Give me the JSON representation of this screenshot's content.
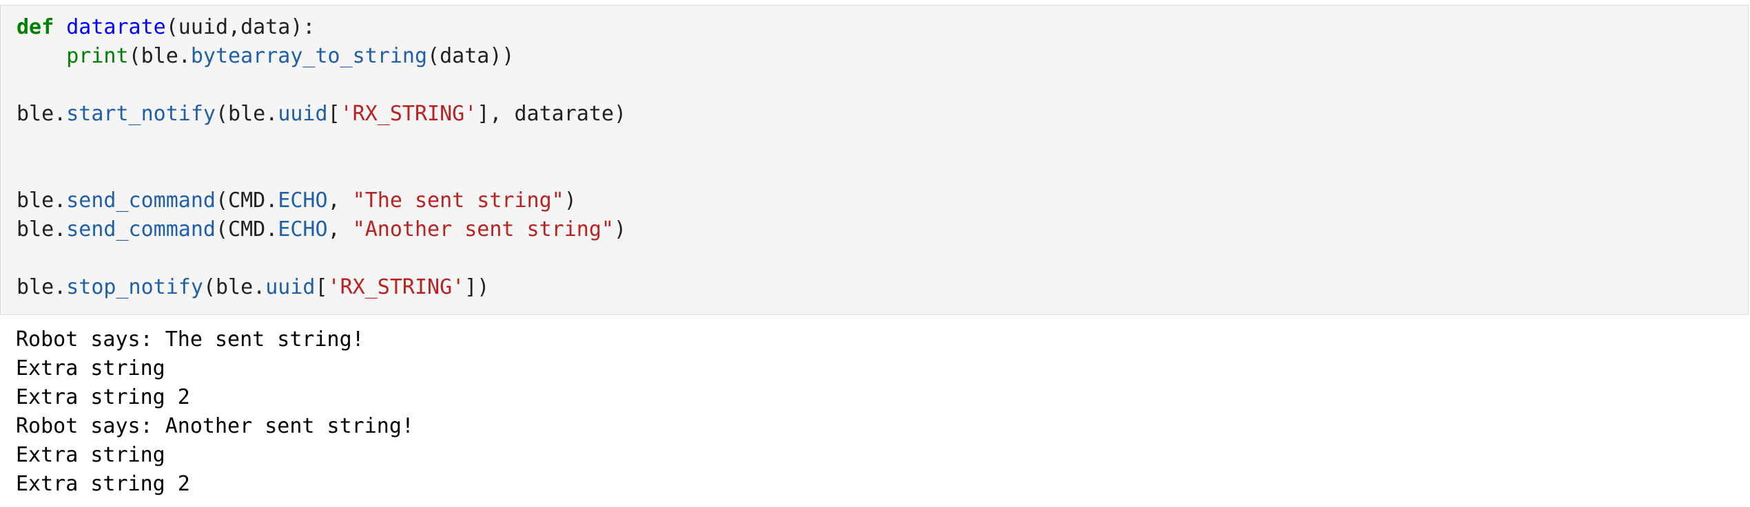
{
  "code_cell": {
    "lines": [
      [
        {
          "text": "def",
          "kind": "kw"
        },
        {
          "text": " ",
          "kind": "plain"
        },
        {
          "text": "datarate",
          "kind": "fn"
        },
        {
          "text": "(uuid,data):",
          "kind": "plain"
        }
      ],
      [
        {
          "text": "    ",
          "kind": "plain"
        },
        {
          "text": "print",
          "kind": "bi"
        },
        {
          "text": "(ble.",
          "kind": "plain"
        },
        {
          "text": "bytearray_to_string",
          "kind": "attr"
        },
        {
          "text": "(data))",
          "kind": "plain"
        }
      ],
      [],
      [
        {
          "text": "ble.",
          "kind": "plain"
        },
        {
          "text": "start_notify",
          "kind": "attr"
        },
        {
          "text": "(ble.",
          "kind": "plain"
        },
        {
          "text": "uuid",
          "kind": "attr"
        },
        {
          "text": "[",
          "kind": "plain"
        },
        {
          "text": "'RX_STRING'",
          "kind": "str"
        },
        {
          "text": "], datarate)",
          "kind": "plain"
        }
      ],
      [],
      [],
      [
        {
          "text": "ble.",
          "kind": "plain"
        },
        {
          "text": "send_command",
          "kind": "attr"
        },
        {
          "text": "(CMD.",
          "kind": "plain"
        },
        {
          "text": "ECHO",
          "kind": "attr"
        },
        {
          "text": ", ",
          "kind": "plain"
        },
        {
          "text": "\"The sent string\"",
          "kind": "str"
        },
        {
          "text": ")",
          "kind": "plain"
        }
      ],
      [
        {
          "text": "ble.",
          "kind": "plain"
        },
        {
          "text": "send_command",
          "kind": "attr"
        },
        {
          "text": "(CMD.",
          "kind": "plain"
        },
        {
          "text": "ECHO",
          "kind": "attr"
        },
        {
          "text": ", ",
          "kind": "plain"
        },
        {
          "text": "\"Another sent string\"",
          "kind": "str"
        },
        {
          "text": ")",
          "kind": "plain"
        }
      ],
      [],
      [
        {
          "text": "ble.",
          "kind": "plain"
        },
        {
          "text": "stop_notify",
          "kind": "attr"
        },
        {
          "text": "(ble.",
          "kind": "plain"
        },
        {
          "text": "uuid",
          "kind": "attr"
        },
        {
          "text": "[",
          "kind": "plain"
        },
        {
          "text": "'RX_STRING'",
          "kind": "str"
        },
        {
          "text": "])",
          "kind": "plain"
        }
      ]
    ]
  },
  "output": {
    "lines": [
      "Robot says: The sent string!",
      "Extra string",
      "Extra string 2",
      "Robot says: Another sent string!",
      "Extra string",
      "Extra string 2"
    ]
  },
  "colors": {
    "keyword": "#008000",
    "function_name": "#0000ff",
    "builtin": "#008000",
    "attribute": "#1f5fa8",
    "string": "#ba2121",
    "cell_background": "#f5f5f5"
  }
}
